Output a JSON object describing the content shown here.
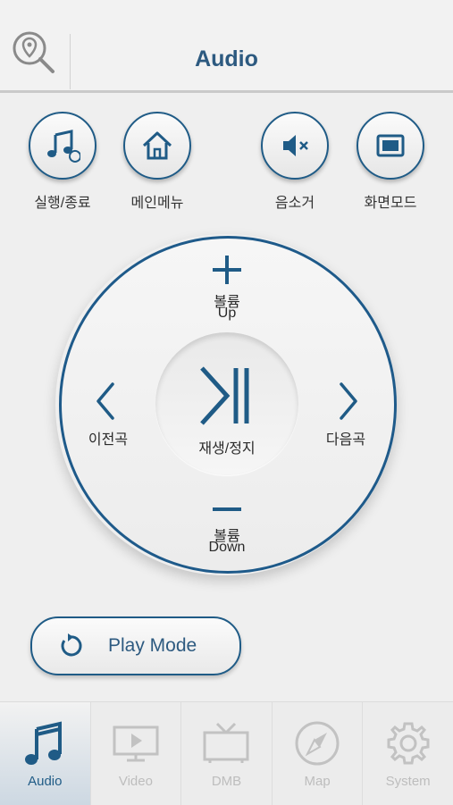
{
  "header": {
    "title": "Audio",
    "search_icon": "map-pin-search-icon"
  },
  "quick_buttons": [
    {
      "label": "실행/종료",
      "icon": "music-note-icon"
    },
    {
      "label": "메인메뉴",
      "icon": "home-icon"
    },
    {
      "label": "음소거",
      "icon": "mute-icon"
    },
    {
      "label": "화면모드",
      "icon": "screen-icon"
    }
  ],
  "dial": {
    "vol_up_line1": "볼륨",
    "vol_up_line2": "Up",
    "vol_down_line1": "볼륨",
    "vol_down_line2": "Down",
    "prev": "이전곡",
    "next": "다음곡",
    "play_pause": "재생/정지"
  },
  "play_mode": {
    "label": "Play Mode",
    "icon": "repeat-icon"
  },
  "tabs": [
    {
      "label": "Audio",
      "icon": "music-note-icon",
      "active": true
    },
    {
      "label": "Video",
      "icon": "video-icon",
      "active": false
    },
    {
      "label": "DMB",
      "icon": "tv-icon",
      "active": false
    },
    {
      "label": "Map",
      "icon": "compass-icon",
      "active": false
    },
    {
      "label": "System",
      "icon": "gear-icon",
      "active": false
    }
  ],
  "colors": {
    "accent": "#1f5b86",
    "inactive": "#bdbdbd",
    "background": "#efefef"
  }
}
